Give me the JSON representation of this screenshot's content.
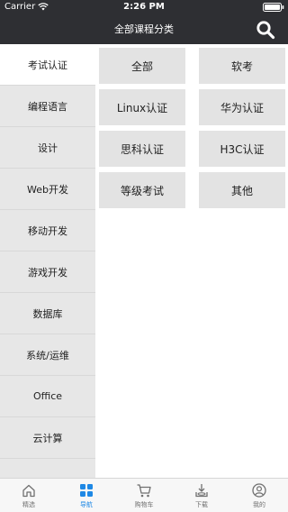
{
  "status_bar": {
    "carrier": "Carrier",
    "time": "2:26 PM"
  },
  "header": {
    "title": "全部课程分类",
    "search_icon": "search-icon"
  },
  "sidebar": {
    "items": [
      {
        "label": "考试认证",
        "active": true
      },
      {
        "label": "编程语言",
        "active": false
      },
      {
        "label": "设计",
        "active": false
      },
      {
        "label": "Web开发",
        "active": false
      },
      {
        "label": "移动开发",
        "active": false
      },
      {
        "label": "游戏开发",
        "active": false
      },
      {
        "label": "数据库",
        "active": false
      },
      {
        "label": "系统/运维",
        "active": false
      },
      {
        "label": "Office",
        "active": false
      },
      {
        "label": "云计算",
        "active": false
      }
    ]
  },
  "categories": [
    {
      "label": "全部"
    },
    {
      "label": "软考"
    },
    {
      "label": "Linux认证"
    },
    {
      "label": "华为认证"
    },
    {
      "label": "思科认证"
    },
    {
      "label": "H3C认证"
    },
    {
      "label": "等级考试"
    },
    {
      "label": "其他"
    }
  ],
  "tabbar": {
    "items": [
      {
        "label": "精选",
        "icon": "home-icon",
        "active": false
      },
      {
        "label": "导航",
        "icon": "grid-icon",
        "active": true
      },
      {
        "label": "购物车",
        "icon": "cart-icon",
        "active": false
      },
      {
        "label": "下载",
        "icon": "download-icon",
        "active": false
      },
      {
        "label": "我的",
        "icon": "profile-icon",
        "active": false
      }
    ]
  },
  "colors": {
    "header_bg": "#2e2f33",
    "sidebar_bg": "#e7e7e7",
    "chip_bg": "#e3e3e3",
    "tab_active": "#1e88e5",
    "tab_inactive": "#707070"
  }
}
